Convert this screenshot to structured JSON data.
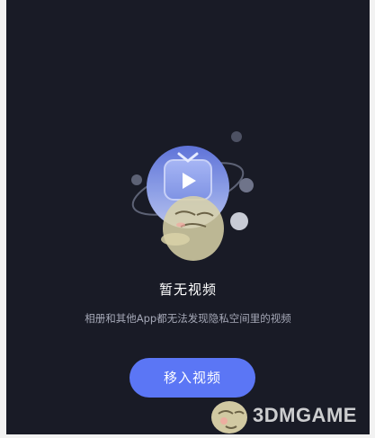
{
  "empty_state": {
    "illustration_icon": "robot-balloon-illustration",
    "title": "暂无视频",
    "description": "相册和其他App都无法发现隐私空间里的视频",
    "action_label": "移入视频"
  },
  "watermark": {
    "text": "3DMGAME",
    "icon": "mascot-logo"
  },
  "colors": {
    "background": "#191b26",
    "accent": "#5b76f5",
    "description": "#a5a8b7"
  }
}
